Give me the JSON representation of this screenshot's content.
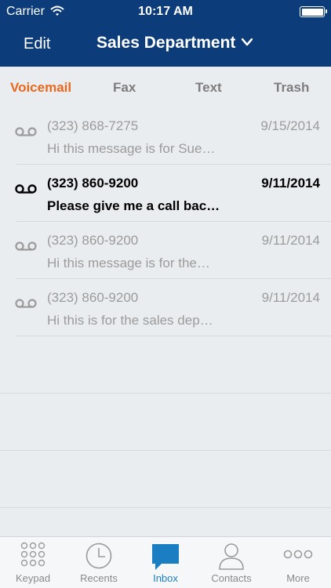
{
  "status_bar": {
    "carrier": "Carrier",
    "time": "10:17 AM"
  },
  "nav": {
    "edit_label": "Edit",
    "title": "Sales Department"
  },
  "tabs": [
    {
      "label": "Voicemail",
      "active": true
    },
    {
      "label": "Fax",
      "active": false
    },
    {
      "label": "Text",
      "active": false
    },
    {
      "label": "Trash",
      "active": false
    }
  ],
  "messages": [
    {
      "phone": "(323) 868-7275",
      "date": "9/15/2014",
      "preview": "Hi this message is for Sue…",
      "unread": false
    },
    {
      "phone": "(323) 860-9200",
      "date": "9/11/2014",
      "preview": "Please give me a call bac…",
      "unread": true
    },
    {
      "phone": "(323) 860-9200",
      "date": "9/11/2014",
      "preview": "Hi this message is for the…",
      "unread": false
    },
    {
      "phone": "(323) 860-9200",
      "date": "9/11/2014",
      "preview": "Hi this is for the sales dep…",
      "unread": false
    }
  ],
  "tab_bar": [
    {
      "label": "Keypad",
      "icon": "keypad-icon",
      "active": false
    },
    {
      "label": "Recents",
      "icon": "clock-icon",
      "active": false
    },
    {
      "label": "Inbox",
      "icon": "chat-bubble-icon",
      "active": true
    },
    {
      "label": "Contacts",
      "icon": "person-icon",
      "active": false
    },
    {
      "label": "More",
      "icon": "more-dots-icon",
      "active": false
    }
  ],
  "colors": {
    "nav_background": "#0c3c79",
    "active_tab": "#e8681e",
    "active_tab_bar": "#1b7ec2"
  }
}
